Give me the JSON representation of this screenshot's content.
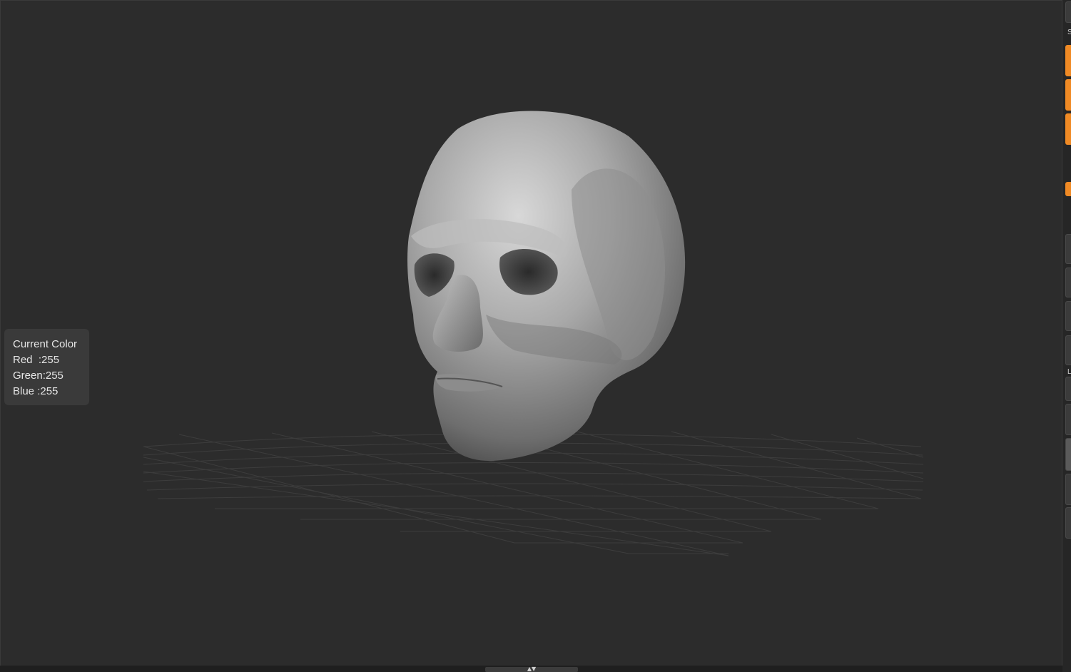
{
  "tooltip": {
    "title": "Current Color",
    "red": "Red  :255",
    "green": "Green:255",
    "blue": "Blue :255"
  },
  "rightbar": {
    "letter_top": "S",
    "letter_mid": "L"
  },
  "colors": {
    "accent": "#f08a24",
    "background": "#2c2c2c"
  },
  "icons": {
    "collapse": "collapse-arrows-icon"
  }
}
